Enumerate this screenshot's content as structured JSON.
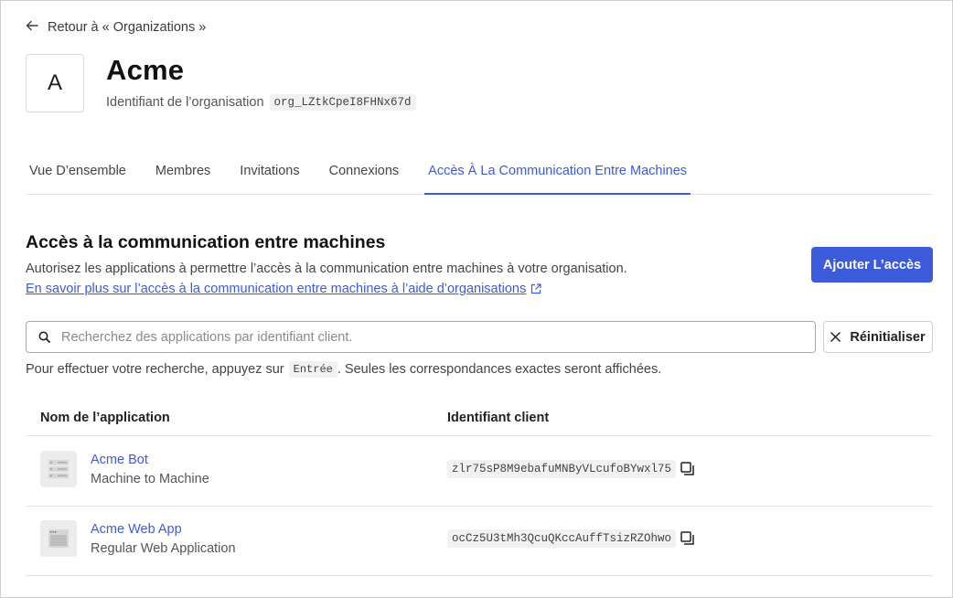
{
  "back_link": {
    "label": "Retour à « Organizations »"
  },
  "org": {
    "avatar_letter": "A",
    "name": "Acme",
    "id_label": "Identifiant de l’organisation",
    "id_value": "org_LZtkCpeI8FHNx67d"
  },
  "tabs": [
    {
      "label": "Vue D’ensemble"
    },
    {
      "label": "Membres"
    },
    {
      "label": "Invitations"
    },
    {
      "label": "Connexions"
    },
    {
      "label": "Accès À La Communication Entre Machines",
      "active": true
    }
  ],
  "section": {
    "title": "Accès à la communication entre machines",
    "description": "Autorisez les applications à permettre l’accès à la communication entre machines à votre organisation.",
    "link": "En savoir plus sur l’accès à la communication entre machines à l’aide d’organisations",
    "add_button": "Ajouter L’accès"
  },
  "search": {
    "placeholder": "Recherchez des applications par identifiant client.",
    "value": "",
    "reset_label": "Réinitialiser",
    "hint_before": "Pour effectuer votre recherche, appuyez sur",
    "hint_key": "Entrée",
    "hint_after": ". Seules les correspondances exactes seront affichées."
  },
  "table": {
    "columns": [
      "Nom de l’application",
      "Identifiant client"
    ],
    "rows": [
      {
        "name": "Acme Bot",
        "type": "Machine to Machine",
        "client_id": "zlr75sP8M9ebafuMNByVLcufoBYwxl75",
        "icon": "server-icon"
      },
      {
        "name": "Acme Web App",
        "type": "Regular Web Application",
        "client_id": "ocCz5U3tMh3QcuQKccAuffTsizRZOhwo",
        "icon": "browser-window-icon"
      }
    ]
  },
  "colors": {
    "accent": "#3b5bdb",
    "text": "#1f1f1f",
    "border": "#e4e4e4"
  }
}
